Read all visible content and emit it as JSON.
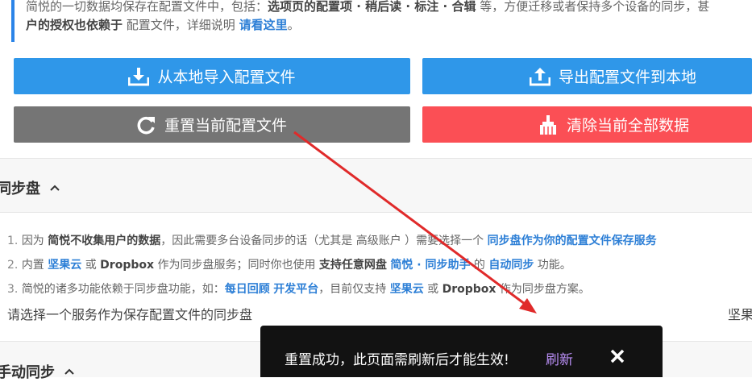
{
  "note": {
    "prefix": "简悦的一切数据均保存在配置文件中，包括：",
    "items": "选项页的配置项 · 稍后读 · 标注 · 合辑",
    "suffix": " 等，方便迁移或者保持多个设备的同步，甚",
    "line2_bold": "户的授权也依赖于",
    "line2_text": " 配置文件，详细说明 ",
    "line2_link": "请看这里",
    "line2_end": "。"
  },
  "buttons": {
    "import": "从本地导入配置文件",
    "export": "导出配置文件到本地",
    "reset": "重置当前配置文件",
    "clear": "清除当前全部数据"
  },
  "sync_section": {
    "title": "同步盘",
    "item1": {
      "num": "1. ",
      "a": "因为 ",
      "b": "简悦不收集用户的数据",
      "c": "，因此需要多台设备同步的话（尤其是 高级账户 ）需要选择一个 ",
      "d": "同步盘作为你的配置文件保存服务"
    },
    "item2": {
      "num": "2. ",
      "a": "内置 ",
      "b": "坚果云",
      "c": " 或 ",
      "d": "Dropbox",
      "e": " 作为同步盘服务；同时你也使用 ",
      "f": "支持任意网盘",
      "g": " ",
      "h": "简悦 · 同步助手",
      "i": " 的 ",
      "j": "自动同步",
      "k": " 功能。"
    },
    "item3": {
      "num": "3. ",
      "a": "简悦的诸多功能依赖于同步盘功能，如：",
      "b": "每日回顾",
      "c": " ",
      "d": "开发平台",
      "e": "，目前仅支持 ",
      "f": "坚果云",
      "g": " 或 ",
      "h": "Dropbox",
      "i": " 作为同步盘方案。"
    },
    "choose_label": "请选择一个服务作为保存配置文件的同步盘",
    "choose_value": "坚果"
  },
  "manual_section": {
    "title": "手动同步"
  },
  "toast": {
    "message": "重置成功，此页面需刷新后才能生效!",
    "action": "刷新"
  },
  "colors": {
    "primary": "#2f97e9",
    "reset": "#757575",
    "danger": "#fb4f55",
    "link": "#2d7fd6",
    "toast_bg": "#121212",
    "toast_action": "#b98ef5",
    "arrow": "#e02a2a"
  }
}
